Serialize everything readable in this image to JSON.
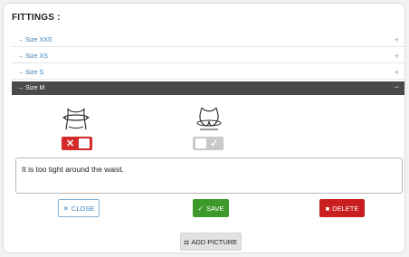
{
  "section": {
    "title": "FITTINGS :"
  },
  "sizes": [
    {
      "label": "→ Size XXS",
      "toggle": "+"
    },
    {
      "label": "→ Size XS",
      "toggle": "+"
    },
    {
      "label": "→ Size S",
      "toggle": "+"
    },
    {
      "label": "→ Size M",
      "toggle": "−"
    }
  ],
  "fit_toggles": {
    "waist": {
      "state": "off",
      "icon": "✕"
    },
    "hips": {
      "state": "on",
      "icon": "✓"
    }
  },
  "comment": {
    "value": "It is too tight around the waist."
  },
  "buttons": {
    "close": "CLOSE",
    "close_icon": "✕",
    "save": "SAVE",
    "save_icon": "✓",
    "delete": "DELETE",
    "delete_icon": "■",
    "add_picture": "ADD PICTURE",
    "add_picture_icon": "◘"
  },
  "colors": {
    "link": "#3b7fb6",
    "active_header": "#4a4a4a",
    "danger": "#d42a2a",
    "success": "#3d9a2a"
  }
}
